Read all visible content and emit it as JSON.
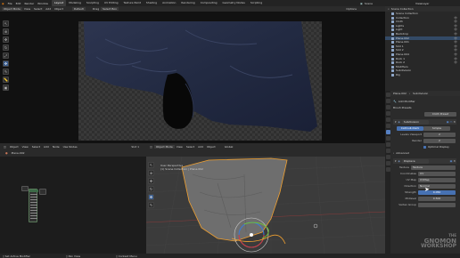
{
  "menu": [
    "File",
    "Edit",
    "Render",
    "Window",
    "Help"
  ],
  "workspace_tabs": [
    {
      "label": "Layout",
      "active": true
    },
    {
      "label": "Modeling",
      "active": false
    },
    {
      "label": "Sculpting",
      "active": false
    },
    {
      "label": "UV Editing",
      "active": false
    },
    {
      "label": "Texture Paint",
      "active": false
    },
    {
      "label": "Shading",
      "active": false
    },
    {
      "label": "Animation",
      "active": false
    },
    {
      "label": "Rendering",
      "active": false
    },
    {
      "label": "Compositing",
      "active": false
    },
    {
      "label": "Geometry Nodes",
      "active": false
    },
    {
      "label": "Scripting",
      "active": false
    }
  ],
  "scene": {
    "label": "Scene",
    "layer": "ViewLayer"
  },
  "tool_header": {
    "mode": "Object Mode",
    "items": [
      "View",
      "Select",
      "Add",
      "Object"
    ],
    "orientation": "Default",
    "drag": "Drag",
    "select_box": "Select Box",
    "options": "Options"
  },
  "outliner": {
    "title": "Scene Collection",
    "rows": [
      {
        "label": "Scene Collection",
        "sel": false,
        "vis": ""
      },
      {
        "label": "Collection",
        "sel": false,
        "vis": "👁"
      },
      {
        "label": "Cloth",
        "sel": false,
        "vis": "👁"
      },
      {
        "label": "Lights",
        "sel": false,
        "vis": "👁"
      },
      {
        "label": "Light",
        "sel": false,
        "vis": "👁"
      },
      {
        "label": "Backdrop",
        "sel": false,
        "vis": "👁"
      },
      {
        "label": "Plane.002",
        "sel": true,
        "vis": "👁"
      },
      {
        "label": "Plane.001",
        "sel": false,
        "vis": "👁"
      },
      {
        "label": "Slot 1",
        "sel": false,
        "vis": "👁"
      },
      {
        "label": "Slot 2",
        "sel": false,
        "vis": "👁"
      },
      {
        "label": "Plane.004",
        "sel": false,
        "vis": "👁"
      },
      {
        "label": "Rock 1",
        "sel": false,
        "vis": "👁"
      },
      {
        "label": "Rock 2",
        "sel": false,
        "vis": "👁"
      },
      {
        "label": "Modifiers",
        "sel": false,
        "vis": ""
      },
      {
        "label": "Subdivision",
        "sel": false,
        "vis": ""
      },
      {
        "label": "Rig",
        "sel": false,
        "vis": ""
      }
    ]
  },
  "properties": {
    "object_name": "Plane.002",
    "modifier_name": "Subdivision",
    "add_modifier": "Add Modifier",
    "brush_presets": "Brush Presets",
    "cloth_preset": "Cloth Preset",
    "modifier1": "Subdivision",
    "simple_label": "Catmull-Clark",
    "simple_alt": "Simple",
    "levels_label": "Levels Viewport",
    "levels_value": "2",
    "render_label": "Render",
    "render_value": "2",
    "optimal_display": "Optimal Display",
    "advanced": "Advanced",
    "modifier2": "Displace",
    "texture_label": "Texture",
    "texture_value": "Texture",
    "coords_label": "Coordinates",
    "coords_value": "UV",
    "uvmap_label": "UV Map",
    "uvmap_value": "UVMap",
    "direction_label": "Direction",
    "direction_value": "Normal",
    "strength_label": "Strength",
    "strength_value": "0.050",
    "midlevel_label": "Midlevel",
    "midlevel_value": "0.500",
    "vgroup_label": "Vertex Group",
    "vgroup_value": "",
    "tooltip": "Add Modifier"
  },
  "node_editor": {
    "mode": "Object",
    "items": [
      "View",
      "Select",
      "Add",
      "Node"
    ],
    "use_nodes": "Use Nodes",
    "slot": "Slot 1",
    "material": "Plane.002",
    "node_label": "Principled BSDF"
  },
  "viewport3d": {
    "mode": "Object Mode",
    "items": [
      "View",
      "Select",
      "Add",
      "Object"
    ],
    "info_line1": "User Perspective",
    "info_line2": "(1) Scene Collection | Plane.002",
    "shading": "Global"
  },
  "statusbar": {
    "left": "Set Active Modifier",
    "mid": "Pan View",
    "right": "Context Menu"
  },
  "watermark": {
    "line1": "THE",
    "line2": "GNOMON",
    "line3": "WORKSHOP"
  },
  "colors": {
    "accent": "#4772b3",
    "selected_outline": "#f0a030"
  }
}
